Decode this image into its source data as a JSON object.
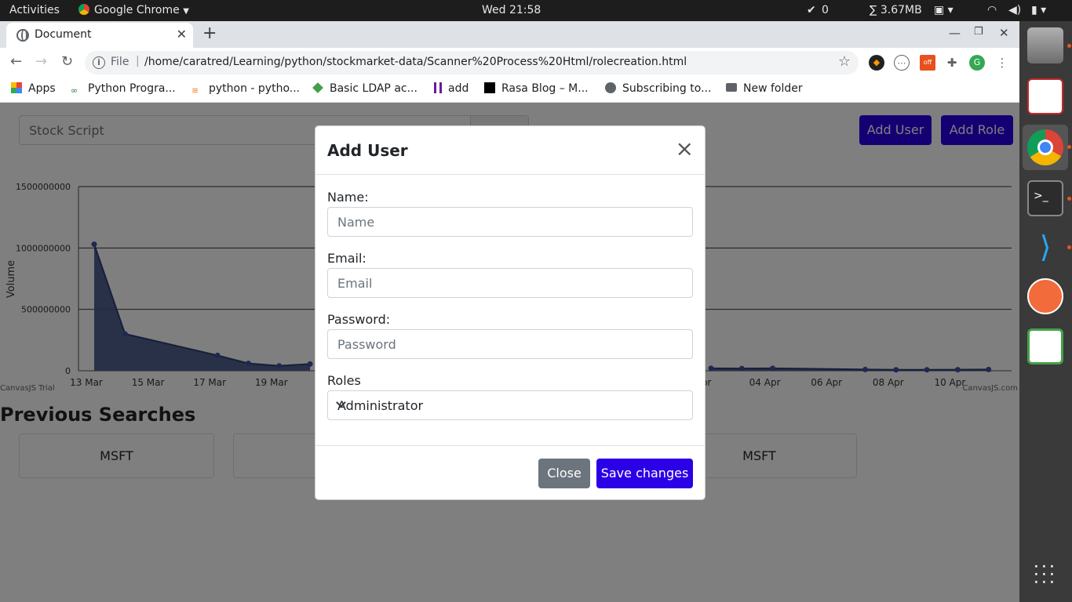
{
  "topbar": {
    "activities": "Activities",
    "app_name": "Google Chrome",
    "clock": "Wed 21:58",
    "check_count": "0",
    "memory": "∑ 3.67MB"
  },
  "browser": {
    "tab_title": "Document",
    "url_scheme": "File",
    "url": "/home/caratred/Learning/python/stockmarket-data/Scanner%20Process%20Html/rolecreation.html",
    "profile_initial": "G",
    "bookmarks": [
      "Apps",
      "Python Progra...",
      "python - pytho...",
      "Basic LDAP ac...",
      "add",
      "Rasa Blog – M...",
      "Subscribing to...",
      "New folder"
    ]
  },
  "page": {
    "search_placeholder": "Stock Script",
    "add_user_label": "Add User",
    "add_role_label": "Add Role",
    "previous_title": "Previous Searches",
    "cards": [
      "MSFT",
      "",
      "MSFT"
    ],
    "trial_text": "CanvasJS Trial",
    "credit_text": "CanvasJS.com"
  },
  "chart_data": {
    "type": "area",
    "ylabel": "Volume",
    "ylim": [
      0,
      1500000000
    ],
    "yticks": [
      "0",
      "500000000",
      "1000000000",
      "1500000000"
    ],
    "xticks_left": [
      "13 Mar",
      "15 Mar",
      "17 Mar",
      "19 Mar"
    ],
    "xticks_right": [
      "Apr",
      "04 Apr",
      "06 Apr",
      "08 Apr",
      "10 Apr"
    ],
    "color": "#4a5b8c",
    "points_left": [
      [
        0,
        1030000000
      ],
      [
        1,
        300000000
      ],
      [
        4,
        125000000
      ],
      [
        5,
        60000000
      ],
      [
        6,
        40000000
      ],
      [
        7,
        55000000
      ]
    ],
    "points_right": [
      [
        20,
        20000000
      ],
      [
        21,
        18000000
      ],
      [
        22,
        20000000
      ],
      [
        25,
        10000000
      ],
      [
        26,
        8000000
      ],
      [
        27,
        8000000
      ],
      [
        28,
        9000000
      ],
      [
        29,
        10000000
      ]
    ],
    "x_tick_positions": {
      "13 Mar": 0,
      "15 Mar": 2,
      "17 Mar": 4,
      "19 Mar": 6,
      "Apr": 20,
      "04 Apr": 22,
      "06 Apr": 24,
      "08 Apr": 26,
      "10 Apr": 28
    }
  },
  "modal": {
    "title": "Add User",
    "close_symbol": "×",
    "name_label": "Name:",
    "name_placeholder": "Name",
    "email_label": "Email:",
    "email_placeholder": "Email",
    "password_label": "Password:",
    "password_placeholder": "Password",
    "roles_label": "Roles",
    "roles_selected": "Administrator",
    "close_button": "Close",
    "save_button": "Save changes",
    "save_color": "#2b00e6",
    "close_color": "#6c757d"
  }
}
